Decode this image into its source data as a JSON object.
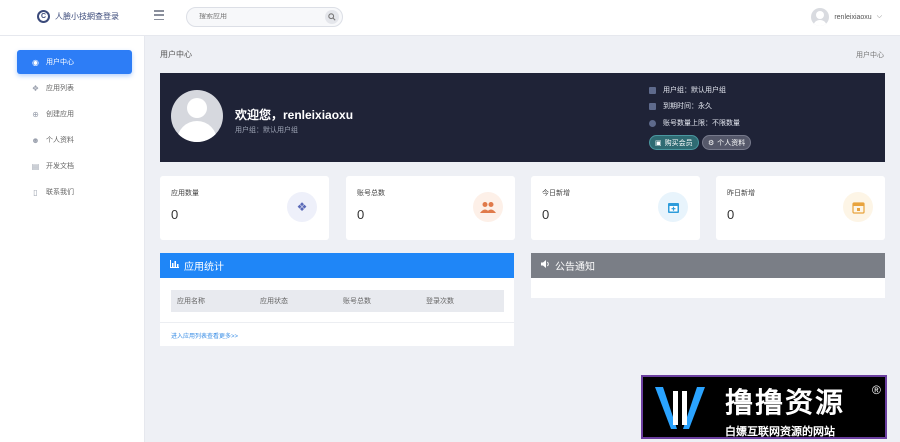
{
  "app": {
    "title": "人臉小技網查登录"
  },
  "search": {
    "placeholder": "搜索应用"
  },
  "user": {
    "name": "renleixiaoxu"
  },
  "sidebar": {
    "items": [
      {
        "label": "用户中心",
        "icon": "user-circle-icon",
        "active": true
      },
      {
        "label": "应用列表",
        "icon": "cubes-icon"
      },
      {
        "label": "创建应用",
        "icon": "plus-circle-icon"
      },
      {
        "label": "个人资料",
        "icon": "users-icon"
      },
      {
        "label": "开发文档",
        "icon": "doc-icon"
      },
      {
        "label": "联系我们",
        "icon": "mobile-icon"
      }
    ]
  },
  "page": {
    "title": "用户中心",
    "breadcrumb": "用户中心"
  },
  "hero": {
    "welcome": "欢迎您，renleixiaoxu",
    "group": "用户组：默认用户组",
    "info": [
      "用户组：默认用户组",
      "到期时间：永久",
      "账号数量上限：不限数量"
    ],
    "buy_label": "购买会员",
    "profile_label": "个人资料"
  },
  "stats": [
    {
      "label": "应用数量",
      "value": "0",
      "icon": "cubes-icon",
      "color": "#5b6ab8",
      "bg": "#eef0fa"
    },
    {
      "label": "账号总数",
      "value": "0",
      "icon": "users-icon",
      "color": "#e07a4a",
      "bg": "#fdf0e8"
    },
    {
      "label": "今日新增",
      "value": "0",
      "icon": "calendar-plus-icon",
      "color": "#2d9cdb",
      "bg": "#e8f4fc"
    },
    {
      "label": "昨日新增",
      "value": "0",
      "icon": "calendar-icon",
      "color": "#e8a33d",
      "bg": "#fdf5e6"
    }
  ],
  "app_stats": {
    "title": "应用统计",
    "columns": [
      "应用名称",
      "应用状态",
      "账号总数",
      "登录次数"
    ],
    "more": "进入应用列表查看更多>>",
    "color": "#1f86f7"
  },
  "notice": {
    "title": "公告通知",
    "color": "#7a7e86"
  },
  "watermark": {
    "title": "撸撸资源",
    "reg": "®",
    "subtitle": "白嫖互联网资源的网站"
  }
}
